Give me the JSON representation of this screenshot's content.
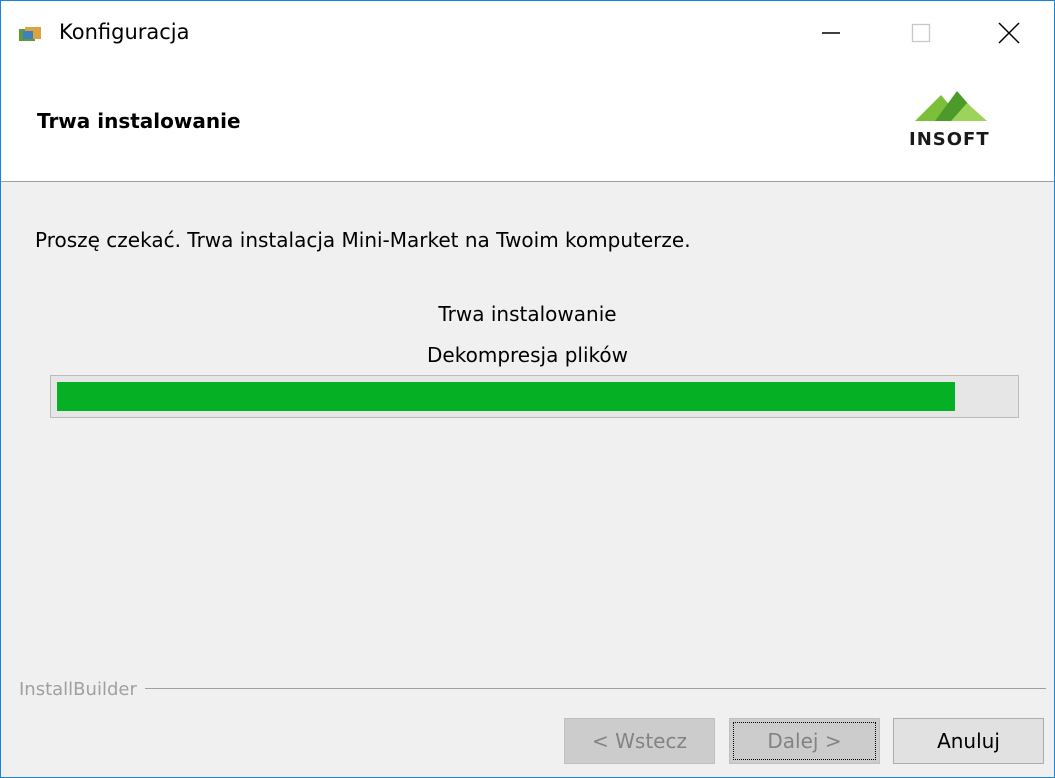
{
  "window": {
    "title": "Konfiguracja",
    "controls": {
      "minimize": "—",
      "maximize": "☐",
      "close": "✕"
    }
  },
  "header": {
    "title": "Trwa instalowanie",
    "logo_text": "INSOFT",
    "logo_icon": "insoft-mountains-logo"
  },
  "body": {
    "message": "Proszę czekać. Trwa instalacja Mini-Market na Twoim komputerze.",
    "status_title": "Trwa instalowanie",
    "status_detail": "Dekompresja plików"
  },
  "progress": {
    "fraction": 0.94,
    "color": "#06b025"
  },
  "footer": {
    "brand": "InstallBuilder",
    "buttons": {
      "back": "< Wstecz",
      "next": "Dalej >",
      "cancel": "Anuluj"
    }
  }
}
